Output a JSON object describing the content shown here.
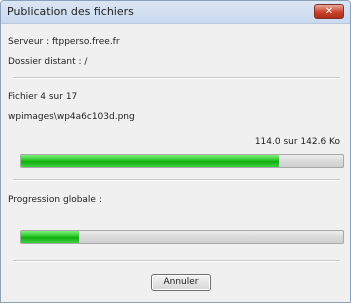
{
  "window": {
    "title": "Publication des fichiers",
    "close_label": "✕"
  },
  "server": {
    "label": "Serveur : ftpperso.free.fr"
  },
  "remote_folder": {
    "label": "Dossier distant : /"
  },
  "file_progress": {
    "counter": "Fichier 4 sur 17",
    "current_file": "wpimages\\wp4a6c103d.png",
    "size_text": "114.0 sur 142.6 Ko",
    "fraction": 0.8
  },
  "global_progress": {
    "label": "Progression globale :",
    "fraction": 0.18
  },
  "buttons": {
    "cancel_label": "Annuler"
  },
  "colors": {
    "progress_green": "#10ad10",
    "close_red": "#c7432b"
  }
}
